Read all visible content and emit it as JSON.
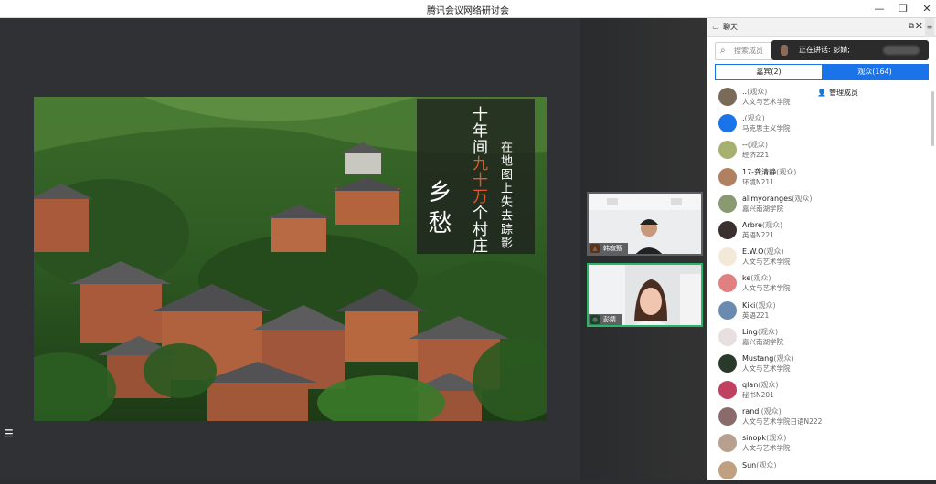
{
  "window": {
    "title": "腾讯会议网络研讨会",
    "controls": {
      "minimize": "—",
      "restore": "❐",
      "close": "✕"
    }
  },
  "slide": {
    "line1_pre": "十年间",
    "line1_hi": "九十万",
    "line1_post": "个村庄",
    "line2": "在地图上失去踪影",
    "big": "乡愁"
  },
  "video_tiles": [
    {
      "name": "韩寂甄",
      "badge_color": "#f07a2a"
    },
    {
      "name": "彭婧",
      "badge_color": "#2fb26a"
    }
  ],
  "panel": {
    "chat_tab": "聊天",
    "members_tab": "管理成员",
    "search_placeholder": "搜索成员",
    "speaking_label": "正在讲话: 彭婧;",
    "seg_guest": "嘉宾(2)",
    "seg_audience": "观众(164)",
    "members": [
      {
        "name": "..",
        "role": "(观众)",
        "dept": "人文与艺术学院",
        "color": "#7a6a5a"
      },
      {
        "name": ".",
        "role": "(观众)",
        "dept": "马克思主义学院",
        "color": "#1a73e8"
      },
      {
        "name": "--",
        "role": "(观众)",
        "dept": "经济221",
        "color": "#a8b070"
      },
      {
        "name": "17-龚清静",
        "role": "(观众)",
        "dept": "环境N211",
        "color": "#b08060"
      },
      {
        "name": "allmyoranges",
        "role": "(观众)",
        "dept": "嘉兴南湖学院",
        "color": "#8a9a70"
      },
      {
        "name": "Arbre",
        "role": "(观众)",
        "dept": "英语N221",
        "color": "#3a3030"
      },
      {
        "name": "E.W.O",
        "role": "(观众)",
        "dept": "人文与艺术学院",
        "color": "#f4e8d8"
      },
      {
        "name": "ke",
        "role": "(观众)",
        "dept": "人文与艺术学院",
        "color": "#e08080"
      },
      {
        "name": "Kiki",
        "role": "(观众)",
        "dept": "英语221",
        "color": "#6a8ab0"
      },
      {
        "name": "Ling",
        "role": "(观众)",
        "dept": "嘉兴南湖学院",
        "color": "#e8e0e0"
      },
      {
        "name": "Mustang",
        "role": "(观众)",
        "dept": "人文与艺术学院",
        "color": "#2a3a2a"
      },
      {
        "name": "qlan",
        "role": "(观众)",
        "dept": "秘书N201",
        "color": "#c04060"
      },
      {
        "name": "randi",
        "role": "(观众)",
        "dept": "人文与艺术学院日语N222",
        "color": "#8a6a6a"
      },
      {
        "name": "sinopk",
        "role": "(观众)",
        "dept": "人文与艺术学院",
        "color": "#b8a090"
      },
      {
        "name": "Sun",
        "role": "(观众)",
        "dept": "",
        "color": "#c0a080"
      }
    ]
  }
}
